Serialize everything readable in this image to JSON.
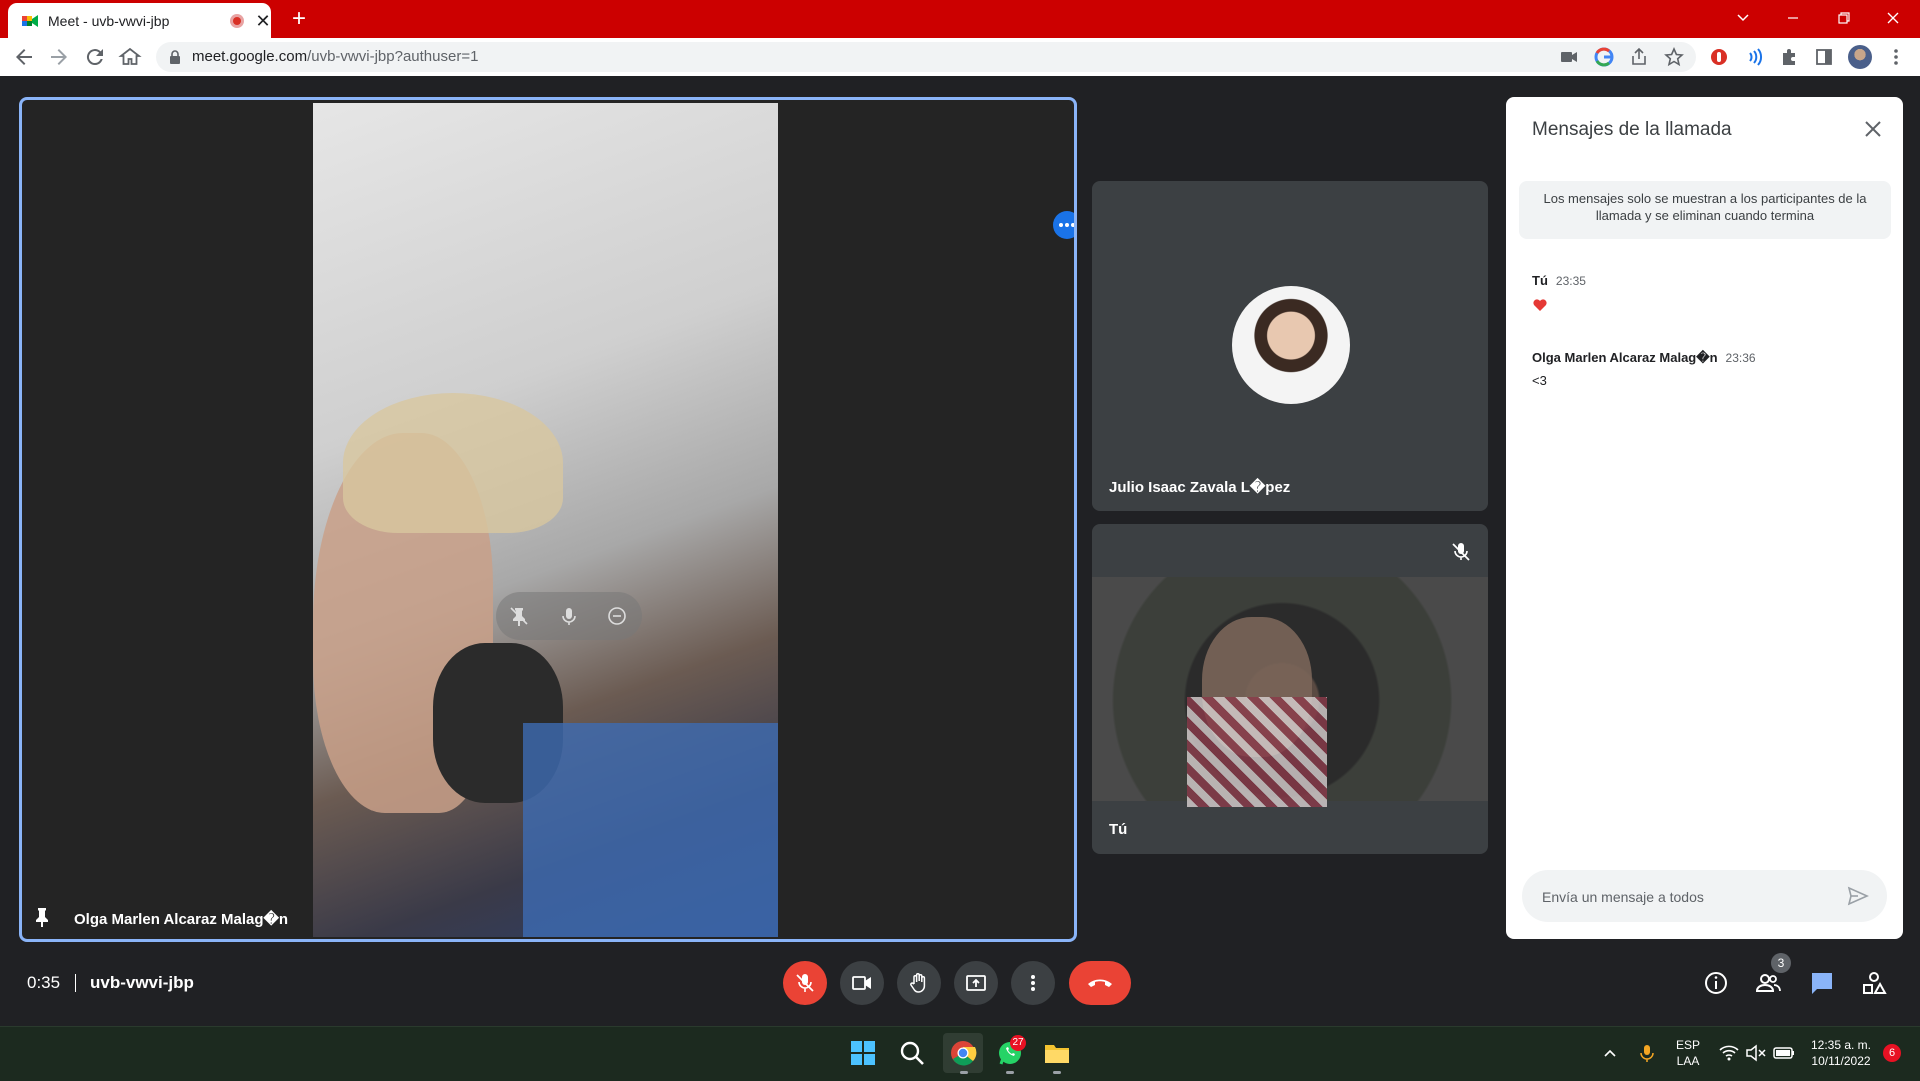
{
  "browser": {
    "tab_title": "Meet - uvb-vwvi-jbp",
    "url_host": "meet.google.com",
    "url_path": "/uvb-vwvi-jbp?authuser=1"
  },
  "meet": {
    "main_participant": "Olga Marlen Alcaraz Malag�n",
    "participants": [
      {
        "name": "Julio Isaac Zavala L�pez"
      },
      {
        "name": "Tú"
      }
    ],
    "elapsed": "0:35",
    "meeting_code": "uvb-vwvi-jbp",
    "participant_count": "3"
  },
  "chat": {
    "title": "Mensajes de la llamada",
    "notice": "Los mensajes solo se muestran a los participantes de la llamada y se eliminan cuando termina",
    "messages": [
      {
        "sender": "Tú",
        "time": "23:35",
        "text": "❤"
      },
      {
        "sender": "Olga Marlen Alcaraz Malag�n",
        "time": "23:36",
        "text": "<3"
      }
    ],
    "input_placeholder": "Envía un mensaje a todos"
  },
  "taskbar": {
    "whatsapp_badge": "27",
    "lang_top": "ESP",
    "lang_bottom": "LAA",
    "clock_time": "12:35 a. m.",
    "clock_date": "10/11/2022",
    "notification_count": "6"
  },
  "colors": {
    "tabbar": "#cc0000",
    "accent": "#1a73e8",
    "danger": "#ea4335",
    "stage": "#202124",
    "tile": "#3c4043"
  },
  "icons": [
    "meet-favicon",
    "record-icon",
    "close-icon",
    "plus-icon",
    "back-icon",
    "forward-icon",
    "reload-icon",
    "home-icon",
    "lock-icon",
    "camera-icon",
    "google-icon",
    "share-icon",
    "star-icon",
    "extension-icon",
    "puzzle-icon",
    "sidepanel-icon",
    "profile-icon",
    "more-vert-icon",
    "pin-icon",
    "mic-off-icon",
    "hand-icon",
    "present-icon",
    "hangup-icon",
    "info-icon",
    "people-icon",
    "chat-icon",
    "activities-icon",
    "send-icon",
    "heart-icon",
    "windows-icon",
    "search-icon",
    "chrome-icon",
    "whatsapp-icon",
    "folder-icon",
    "wifi-icon",
    "volume-icon",
    "battery-icon"
  ]
}
